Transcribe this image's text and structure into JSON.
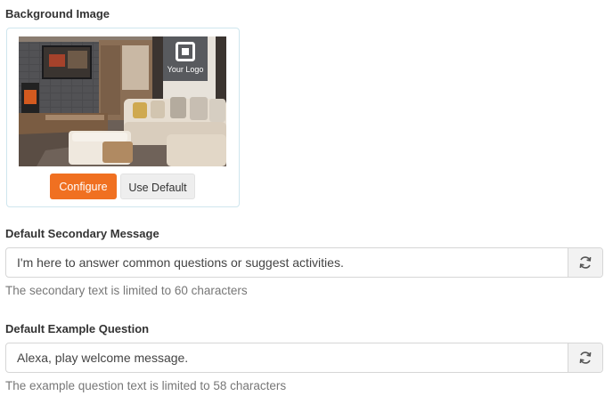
{
  "background": {
    "label": "Background Image",
    "logo_text": "Your Logo",
    "configure_label": "Configure",
    "use_default_label": "Use Default",
    "accent_color": "#f07021"
  },
  "secondary": {
    "label": "Default Secondary Message",
    "value": "I'm here to answer common questions or suggest activities.",
    "help": "The secondary text is limited to 60 characters",
    "reset_icon": "refresh-icon"
  },
  "example": {
    "label": "Default Example Question",
    "value": "Alexa, play welcome message.",
    "help": "The example question text is limited to 58 characters",
    "reset_icon": "refresh-icon"
  }
}
